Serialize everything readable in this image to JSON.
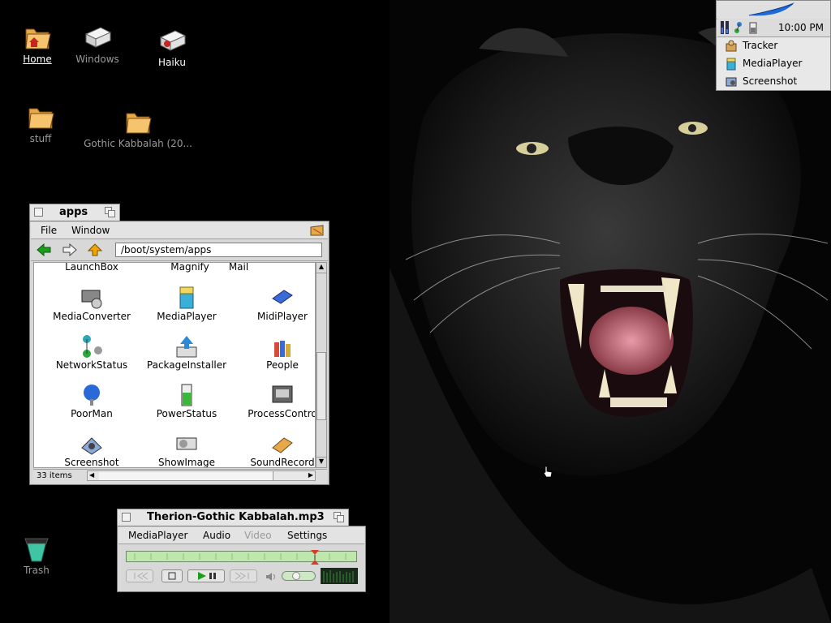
{
  "desktop": {
    "icons": [
      {
        "label": "Home"
      },
      {
        "label": "Windows"
      },
      {
        "label": "Haiku"
      },
      {
        "label": "stuff"
      },
      {
        "label": "Gothic Kabbalah (20..."
      },
      {
        "label": "Trash"
      }
    ]
  },
  "deskbar": {
    "clock": "10:00 PM",
    "apps": [
      {
        "label": "Tracker",
        "icon": "tracker-icon"
      },
      {
        "label": "MediaPlayer",
        "icon": "mediaplayer-icon"
      },
      {
        "label": "Screenshot",
        "icon": "screenshot-icon"
      }
    ]
  },
  "apps_window": {
    "title": "apps",
    "menu": [
      "File",
      "Window"
    ],
    "path": "/boot/system/apps",
    "items_top_cut": [
      "LaunchBox",
      "Magnify",
      "Mail"
    ],
    "items": [
      "MediaConverter",
      "MediaPlayer",
      "MidiPlayer",
      "NetworkStatus",
      "PackageInstaller",
      "People",
      "PoorMan",
      "PowerStatus",
      "ProcessContro",
      "Screenshot",
      "ShowImage",
      "SoundRecord"
    ],
    "status": "33 items"
  },
  "media_window": {
    "title": "Therion-Gothic Kabbalah.mp3",
    "menu": [
      "MediaPlayer",
      "Audio",
      "Video",
      "Settings"
    ],
    "disabled_menu": [
      "Video"
    ],
    "seek_position": 0.82,
    "volume": 0.4
  },
  "colors": {
    "desktop": "#000000",
    "seek_fill": "#bfe7ad",
    "back_arrow": "#1c9e1c",
    "home_arrow": "#f0a400"
  }
}
